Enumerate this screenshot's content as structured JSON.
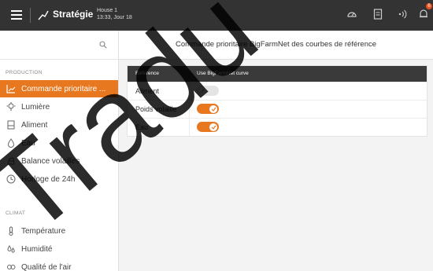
{
  "header": {
    "title": "Stratégie",
    "house_name": "House 1",
    "house_time": "13:33, Jour 18",
    "notification_count": "6",
    "icons": [
      "menu-icon",
      "strategy-chart-icon",
      "dashboard-icon",
      "document-icon",
      "signal-icon",
      "bell-icon"
    ]
  },
  "colors": {
    "accent": "#e8781f",
    "topbar": "#333333",
    "table_header": "#3a3a3a",
    "badge": "#e8501d"
  },
  "sidebar": {
    "search_icon": "search-icon",
    "sections": [
      {
        "label": "PRODUCTION",
        "items": [
          {
            "label": "Commande prioritaire ...",
            "icon": "priority-curve-icon",
            "active": true
          },
          {
            "label": "Lumière",
            "icon": "light-icon",
            "active": false
          },
          {
            "label": "Aliment",
            "icon": "feed-icon",
            "active": false
          },
          {
            "label": "Eau",
            "icon": "water-drop-icon",
            "active": false
          },
          {
            "label": "Balance volailles",
            "icon": "scale-icon",
            "active": false
          },
          {
            "label": "Horloge de 24h",
            "icon": "clock-icon",
            "active": false
          }
        ]
      },
      {
        "label": "CLIMAT",
        "items": [
          {
            "label": "Température",
            "icon": "thermometer-icon",
            "active": false
          },
          {
            "label": "Humidité",
            "icon": "humidity-icon",
            "active": false
          },
          {
            "label": "Qualité de l'air",
            "icon": "air-quality-icon",
            "active": false
          }
        ]
      }
    ]
  },
  "main": {
    "title": "Commande prioritaire BigFarmNet des courbes de référence",
    "table": {
      "headers": [
        "Référence",
        "Use BigFarmNet curve"
      ],
      "rows": [
        {
          "reference": "Aliment",
          "enabled": false
        },
        {
          "reference": "Poids volaille",
          "enabled": true
        },
        {
          "reference": "Eau",
          "enabled": true
        }
      ]
    }
  },
  "watermark_text": "Tradu"
}
